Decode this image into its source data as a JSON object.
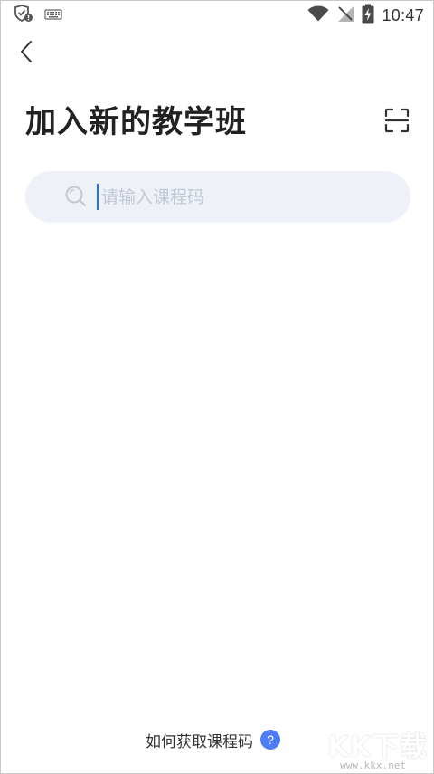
{
  "status_bar": {
    "time": "10:47",
    "icons": [
      "shield-alert-icon",
      "keyboard-icon",
      "wifi-icon",
      "no-signal-icon",
      "battery-charging-icon"
    ]
  },
  "header": {
    "back_icon": "chevron-left-icon",
    "title": "加入新的教学班",
    "scan_icon": "scan-icon"
  },
  "search": {
    "placeholder": "请输入课程码",
    "value": "",
    "icon": "search-icon"
  },
  "footer": {
    "help_label": "如何获取课程码",
    "help_icon": "question-mark-icon"
  },
  "watermark": {
    "logo": "KK下载",
    "url": "www.kkx.net"
  },
  "colors": {
    "accent": "#4e7cf6",
    "caret": "#1a73e8",
    "search_bg": "#eef2f8",
    "title": "#222222"
  }
}
